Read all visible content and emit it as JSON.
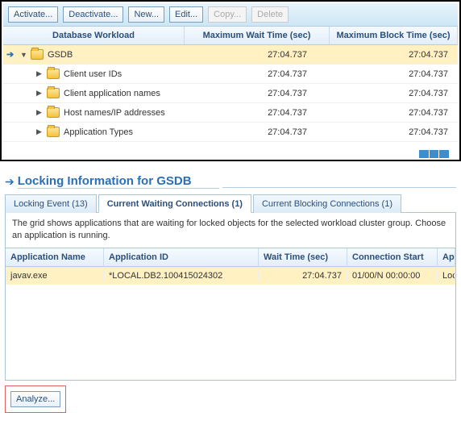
{
  "toolbar": {
    "activate": "Activate...",
    "deactivate": "Deactivate...",
    "new": "New...",
    "edit": "Edit...",
    "copy": "Copy...",
    "delete": "Delete"
  },
  "grid1": {
    "headers": {
      "name": "Database Workload",
      "wait": "Maximum Wait Time (sec)",
      "block": "Maximum Block Time (sec)"
    },
    "root": {
      "label": "GSDB",
      "wait": "27:04.737",
      "block": "27:04.737"
    },
    "children": [
      {
        "label": "Client user IDs",
        "wait": "27:04.737",
        "block": "27:04.737"
      },
      {
        "label": "Client application names",
        "wait": "27:04.737",
        "block": "27:04.737"
      },
      {
        "label": "Host names/IP addresses",
        "wait": "27:04.737",
        "block": "27:04.737"
      },
      {
        "label": "Application Types",
        "wait": "27:04.737",
        "block": "27:04.737"
      }
    ]
  },
  "pane": {
    "title": "Locking Information for GSDB"
  },
  "tabs": {
    "events": "Locking Event (13)",
    "waiting": "Current Waiting Connections (1)",
    "blocking": "Current Blocking Connections (1)"
  },
  "desc": "The grid shows applications that are waiting for locked objects for the selected workload cluster group. Choose an application is running.",
  "grid2": {
    "headers": {
      "app": "Application Name",
      "id": "Application ID",
      "wait": "Wait Time (sec)",
      "conn": "Connection Start",
      "more": "App"
    },
    "rows": [
      {
        "app": "javav.exe",
        "id": "*LOCAL.DB2.100415024302",
        "wait": "27:04.737",
        "conn": "01/00/N 00:00:00",
        "more": "Lock"
      }
    ]
  },
  "bottom": {
    "analyze": "Analyze..."
  }
}
